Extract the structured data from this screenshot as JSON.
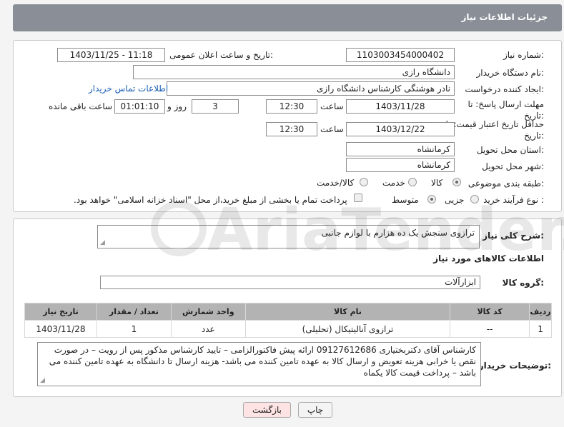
{
  "header": {
    "title": "جزئیات اطلاعات نیاز"
  },
  "form": {
    "need_number_label": "شماره نیاز:",
    "need_number": "1103003454000402",
    "announce_label": "تاریخ و ساعت اعلان عمومی:",
    "announce_value": "1403/11/25 - 11:18",
    "buyer_org_label": "نام دستگاه خریدار:",
    "buyer_org": "دانشگاه رازی",
    "requester_label": "ایجاد کننده درخواست:",
    "requester": "نادر هوشنگی کارشناس دانشگاه رازی",
    "contact_link": "اطلاعات تماس خریدار",
    "deadline_label": "مهلت ارسال پاسخ: تا تاریخ:",
    "deadline_date": "1403/11/28",
    "time_word": "ساعت",
    "deadline_time": "12:30",
    "days": "3",
    "days_word": "روز و",
    "remaining": "01:01:10",
    "remaining_word": "ساعت باقی مانده",
    "validity_label": "حداقل تاریخ اعتبار قیمت: تا تاریخ:",
    "validity_date": "1403/12/22",
    "validity_time": "12:30",
    "province_label": "استان محل تحویل:",
    "province": "کرمانشاه",
    "city_label": "شهر محل تحویل:",
    "city": "کرمانشاه",
    "category_label": "طبقه بندی موضوعی:",
    "category_options": [
      "کالا",
      "خدمت",
      "کالا/خدمت"
    ],
    "process_label": "نوع فرآیند خرید :",
    "process_options": [
      "جزیی",
      "متوسط"
    ],
    "payment_note": "پرداخت تمام یا بخشی از مبلغ خرید،از محل \"اسناد خزانه اسلامی\" خواهد بود."
  },
  "details": {
    "description_label": "شرح کلی نیاز:",
    "description": "ترازوی سنجش یک ده هزارم با لوازم جانبی",
    "goods_info_title": "اطلاعات کالاهای مورد نیاز",
    "group_label": "گروه کالا:",
    "group_value": "ابزارآلات",
    "table": {
      "headers": [
        "ردیف",
        "کد کالا",
        "نام کالا",
        "واحد شمارش",
        "تعداد / مقدار",
        "تاریخ نیاز"
      ],
      "rows": [
        [
          "1",
          "--",
          "ترازوی آنالیتیکال (تحلیلی)",
          "عدد",
          "1",
          "1403/11/28"
        ]
      ]
    },
    "buyer_notes_label": "توضیحات خریدار:",
    "buyer_notes": "کارشناس آقای دکتربختیاری 09127612686  ارائه پیش فاکتورالزامی – تایید کارشناس مذکور پس از رویت – در صورت نقص یا خرابی هزینه تعویض و ارسال کالا به عهده تامین کننده می باشد- هزینه ارسال  تا دانشگاه به عهده تامین کننده می باشد – پرداخت قیمت کالا یکماه"
  },
  "buttons": {
    "print": "چاپ",
    "back": "بازگشت"
  },
  "watermark": {
    "text": "AriaTender.neT"
  },
  "colors": {
    "header": "#8a8f97",
    "link": "#1a5fb4",
    "back_button": "#fde3e3"
  }
}
